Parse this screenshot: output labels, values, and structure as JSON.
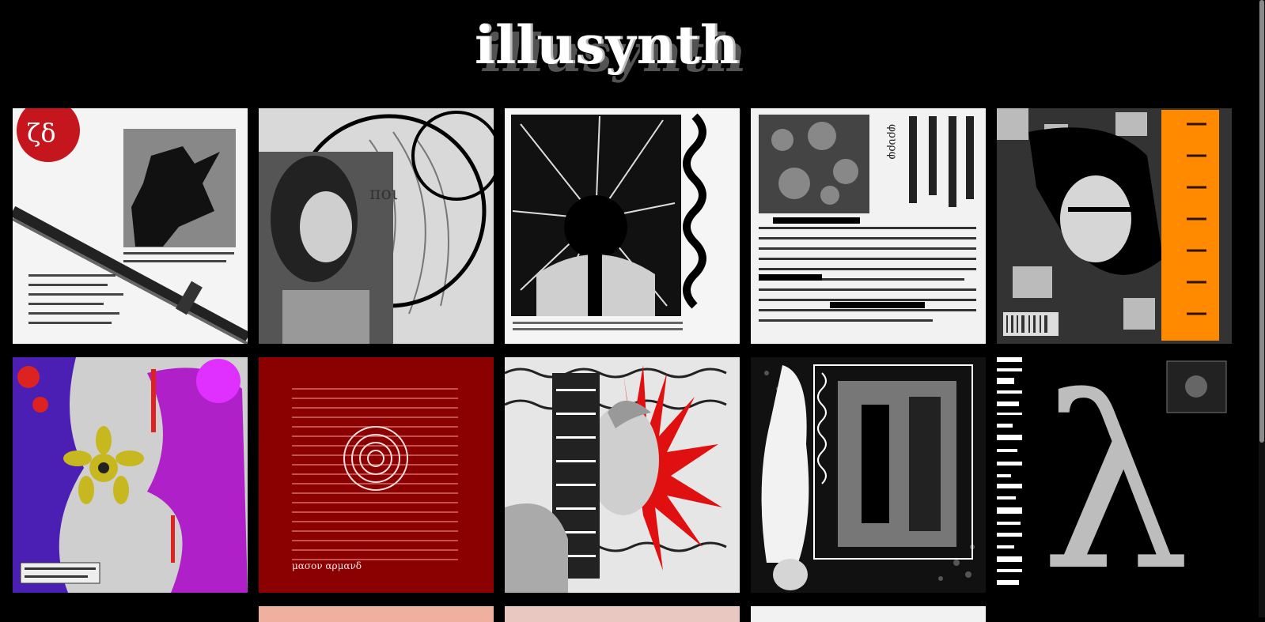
{
  "site": {
    "title": "illusynth"
  },
  "covers": [
    {
      "name": "cover-sword",
      "alt_text": "ζδ"
    },
    {
      "name": "cover-portrait-circle",
      "alt_text": "ποι"
    },
    {
      "name": "cover-explosion",
      "alt_text": ""
    },
    {
      "name": "cover-greek-text",
      "alt_text": "φρυρφ"
    },
    {
      "name": "cover-orange-bar",
      "alt_text": ""
    },
    {
      "name": "cover-purple-abstract",
      "alt_text": ""
    },
    {
      "name": "cover-red-masonarmand",
      "alt_text": "μασον αρμανδ"
    },
    {
      "name": "cover-statue-red",
      "alt_text": ""
    },
    {
      "name": "cover-figure-frame",
      "alt_text": ""
    },
    {
      "name": "cover-lambda",
      "alt_text": "λ"
    }
  ]
}
